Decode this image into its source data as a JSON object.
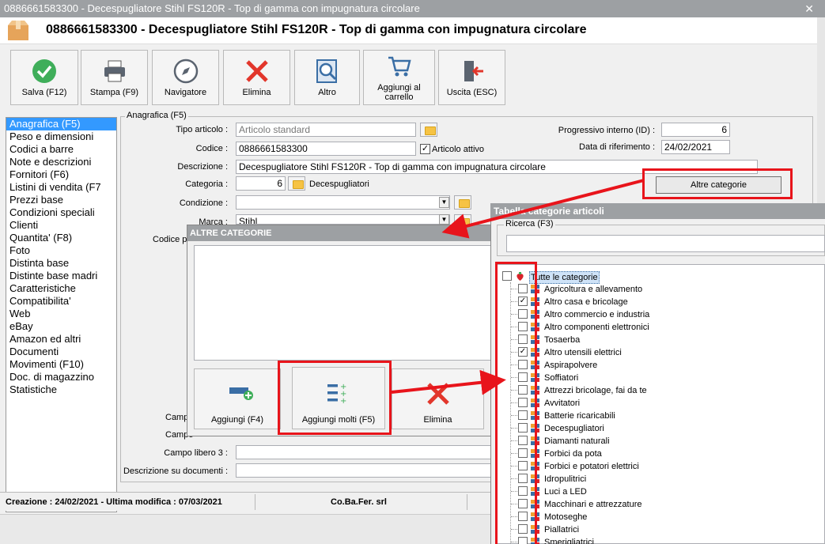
{
  "window": {
    "title": "0886661583300 - Decespugliatore Stihl FS120R - Top di gamma con impugnatura circolare",
    "close": "✕"
  },
  "header": {
    "title": "0886661583300 - Decespugliatore Stihl FS120R - Top di gamma con impugnatura circolare"
  },
  "toolbar": {
    "save": "Salva (F12)",
    "print": "Stampa (F9)",
    "navigator": "Navigatore",
    "delete": "Elimina",
    "other": "Altro",
    "cart_line1": "Aggiungi al",
    "cart_line2": "carrello",
    "exit": "Uscita (ESC)"
  },
  "sidebar": {
    "items": [
      "Anagrafica (F5)",
      "Peso e dimensioni",
      "Codici a barre",
      "Note e descrizioni",
      "Fornitori (F6)",
      "Listini di vendita (F7",
      "Prezzi base",
      "Condizioni speciali",
      "Clienti",
      "Quantita' (F8)",
      "Foto",
      "Distinta base",
      "Distinte base madri",
      "Caratteristiche",
      "Compatibilita'",
      "Web",
      "eBay",
      "Amazon ed altri",
      "Documenti",
      "Movimenti (F10)",
      "Doc. di magazzino",
      "Statistiche"
    ]
  },
  "form": {
    "group_title": "Anagrafica (F5)",
    "tipo_label": "Tipo articolo :",
    "tipo_value": "Articolo standard",
    "codice_label": "Codice :",
    "codice_value": "0886661583300",
    "attivo_label": "Articolo attivo",
    "attivo_check": "✓",
    "descr_label": "Descrizione :",
    "descr_value": "Decespugliatore Stihl FS120R - Top di gamma con impugnatura circolare",
    "cat_label": "Categoria :",
    "cat_value": "6",
    "cat_name": "Decespugliatori",
    "cond_label": "Condizione :",
    "marca_label": "Marca :",
    "marca_value": "Stihl",
    "codice_p_label": "Codice p",
    "campo_label_a": "Campo",
    "campo_label_b": "Campo",
    "campo3_label": "Campo libero 3 :",
    "descr_doc_label": "Descrizione su documenti :",
    "prog_label": "Progressivo interno (ID) :",
    "prog_value": "6",
    "data_label": "Data di riferimento :",
    "data_value": "24/02/2021",
    "altre_btn": "Altre categorie"
  },
  "status": {
    "created": "Creazione : 24/02/2021 - Ultima modifica : 07/03/2021",
    "company": "Co.Ba.Fer. srl"
  },
  "dialog": {
    "title": "ALTRE CATEGORIE",
    "add": "Aggiungi (F4)",
    "add_many": "Aggiungi molti (F5)",
    "delete": "Elimina"
  },
  "categories": {
    "title": "Tabella categorie articoli",
    "search_label": "Ricerca (F3)",
    "root": "Tutte le categorie",
    "check_mark": "✓",
    "items": [
      {
        "label": "Agricoltura e allevamento",
        "checked": false
      },
      {
        "label": "Altro casa e bricolage",
        "checked": true
      },
      {
        "label": "Altro commercio e industria",
        "checked": false
      },
      {
        "label": "Altro componenti elettronici",
        "checked": false
      },
      {
        "label": "Tosaerba",
        "checked": false
      },
      {
        "label": "Altro utensili elettrici",
        "checked": true
      },
      {
        "label": "Aspirapolvere",
        "checked": false
      },
      {
        "label": "Soffiatori",
        "checked": false
      },
      {
        "label": "Attrezzi bricolage, fai da te",
        "checked": false
      },
      {
        "label": "Avvitatori",
        "checked": false
      },
      {
        "label": "Batterie ricaricabili",
        "checked": false
      },
      {
        "label": "Decespugliatori",
        "checked": false
      },
      {
        "label": "Diamanti naturali",
        "checked": false
      },
      {
        "label": "Forbici da pota",
        "checked": false
      },
      {
        "label": "Forbici e potatori elettrici",
        "checked": false
      },
      {
        "label": "Idropulitrici",
        "checked": false
      },
      {
        "label": "Luci a LED",
        "checked": false
      },
      {
        "label": "Macchinari e attrezzature",
        "checked": false
      },
      {
        "label": "Motoseghe",
        "checked": false
      },
      {
        "label": "Piallatrici",
        "checked": false
      },
      {
        "label": "Smerigliatrici",
        "checked": false
      }
    ]
  },
  "colors": {
    "titlebar": "#9da0a3",
    "selection": "#3399ff",
    "annotation_red": "#e8141b"
  }
}
